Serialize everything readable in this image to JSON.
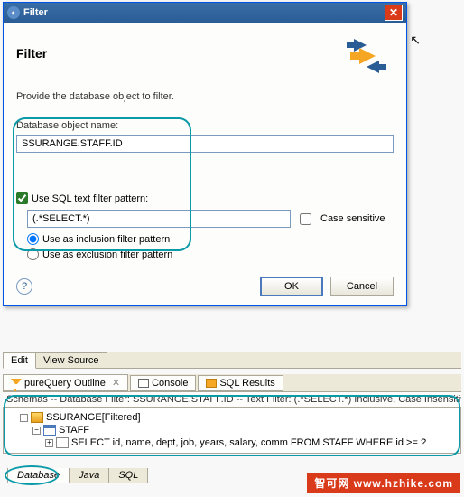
{
  "dialog": {
    "title": "Filter",
    "header": "Filter",
    "instruction": "Provide the database object to filter.",
    "object_name_label": "Database object name:",
    "object_name_value": "SSURANGE.STAFF.ID",
    "use_pattern_label": "Use SQL text filter pattern:",
    "pattern_value": "(.*SELECT.*)",
    "case_sensitive_label": "Case sensitive",
    "radio_inclusion": "Use as inclusion filter pattern",
    "radio_exclusion": "Use as exclusion filter pattern",
    "ok": "OK",
    "cancel": "Cancel"
  },
  "toolbar": {
    "edit": "Edit",
    "view_source": "View Source"
  },
  "views": {
    "pq_outline": "pureQuery Outline",
    "console": "Console",
    "sql_results": "SQL Results"
  },
  "filter_desc": "Schemas -- Database Filter: SSURANGE.STAFF.ID  -- Text Filter: (.*SELECT.*) Inclusive, Case Insensitive",
  "tree": {
    "node0": "SSURANGE[Filtered]",
    "node1": "STAFF",
    "node2": "SELECT id, name, dept, job, years, salary, comm   FROM STAFF   WHERE id >= ?"
  },
  "bottom_tabs": {
    "database": "Database",
    "java": "Java",
    "sql": "SQL"
  },
  "watermark": "智可网 www.hzhike.com"
}
